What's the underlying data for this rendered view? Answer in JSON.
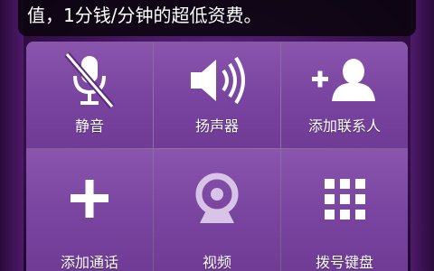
{
  "banner": {
    "text": "值，1分钱/分钟的超低资费。"
  },
  "keys": [
    {
      "label": "静音",
      "icon": "mic-muted-icon"
    },
    {
      "label": "扬声器",
      "icon": "speaker-icon"
    },
    {
      "label": "添加联系人",
      "icon": "add-contact-icon"
    },
    {
      "label": "添加通话",
      "icon": "plus-icon"
    },
    {
      "label": "视频",
      "icon": "webcam-icon"
    },
    {
      "label": "拨号键盘",
      "icon": "keypad-icon"
    }
  ],
  "colors": {
    "accent": "#7a45a0",
    "background": "#3a1250"
  }
}
